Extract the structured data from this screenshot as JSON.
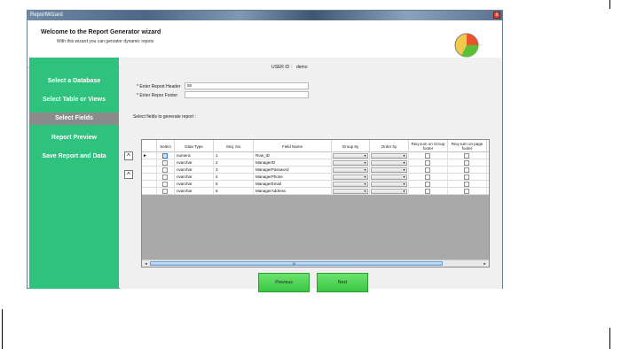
{
  "window": {
    "title": "ReportWizard",
    "close_glyph": "x"
  },
  "header": {
    "title": "Welcome to the Report Generator wizard",
    "subtitle": "With this wizard you can genrator dynamic repots",
    "logo_icon": "pie-chart-icon"
  },
  "sidebar": {
    "items": [
      {
        "label": "Select a Database"
      },
      {
        "label": "Select Table or Views"
      },
      {
        "label": "Select Fields",
        "active": true
      },
      {
        "label": "Report Preview"
      },
      {
        "label": "Save Report and Data"
      }
    ],
    "bg_color": "#2ec27e",
    "active_color": "#8b8b8b"
  },
  "form": {
    "user_label": "USER ID :",
    "user_value": "demo",
    "header_label": "* Enter Report Header",
    "header_value": "ss",
    "footer_label": "* Enter Repor Footer",
    "footer_value": "",
    "fields_label": "Select fields to generate report :"
  },
  "grid": {
    "columns": [
      "Select",
      "Data Type",
      "Seq. No",
      "Field Name",
      "Group by",
      "Order by",
      "Req sum on Group footer",
      "Req sum on page footer"
    ],
    "rows": [
      {
        "type": "numeric",
        "seq": "1",
        "field": "Row_ID",
        "current": true
      },
      {
        "type": "nvarchar",
        "seq": "2",
        "field": "ManagerID"
      },
      {
        "type": "nvarchar",
        "seq": "3",
        "field": "ManagerPassword"
      },
      {
        "type": "nvarchar",
        "seq": "4",
        "field": "ManagerPhone"
      },
      {
        "type": "nvarchar",
        "seq": "5",
        "field": "ManagerEmail"
      },
      {
        "type": "nvarchar",
        "seq": "6",
        "field": "ManagerAddress"
      }
    ],
    "row_indicator": "►",
    "scroll_left": "◄",
    "scroll_right": "►",
    "scroll_grip": "III"
  },
  "reorder": {
    "up_glyph": "^",
    "down_glyph": "^"
  },
  "buttons": {
    "previous": "Previous",
    "next": "Next"
  }
}
